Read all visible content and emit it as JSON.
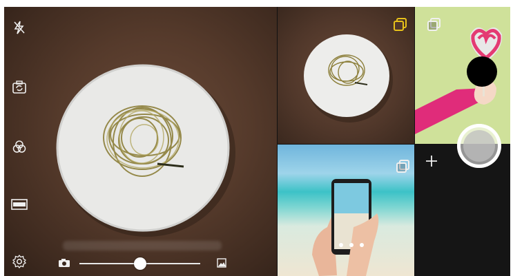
{
  "viewfinder": {
    "icons": [
      "flash-off-icon",
      "switch-camera-icon",
      "filter-icon",
      "aspect-ratio-icon",
      "settings-icon"
    ],
    "zoom_level": 0.5
  },
  "tiles": [
    {
      "name": "food-tile",
      "selected": true
    },
    {
      "name": "lollipop-tile",
      "selected": false
    },
    {
      "name": "beach-tile",
      "selected": false
    },
    {
      "name": "empty-tile",
      "selected": false
    }
  ],
  "colors": {
    "accent": "#e8c21a",
    "icon": "#f0f0f0"
  }
}
